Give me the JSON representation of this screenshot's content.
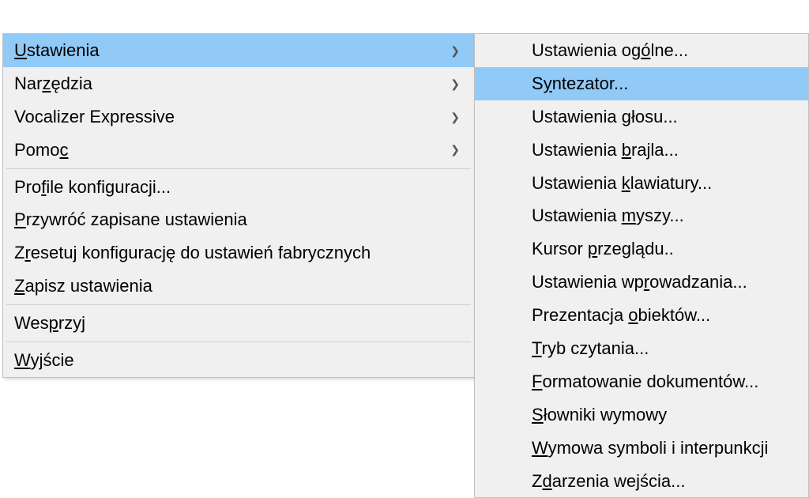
{
  "leftMenu": {
    "items": [
      {
        "label": "Ustawienia",
        "underlineIndex": 0,
        "hasArrow": true,
        "highlight": true
      },
      {
        "label": "Narzędzia",
        "underlineIndex": 3,
        "hasArrow": true,
        "highlight": false
      },
      {
        "label": "Vocalizer Expressive",
        "underlineIndex": -1,
        "hasArrow": true,
        "highlight": false
      },
      {
        "label": "Pomoc",
        "underlineIndex": 4,
        "hasArrow": true,
        "highlight": false
      }
    ],
    "items2": [
      {
        "label": "Profile konfiguracji...",
        "underlineIndex": 3,
        "hasArrow": false,
        "highlight": false
      },
      {
        "label": "Przywróć zapisane ustawienia",
        "underlineIndex": 0,
        "hasArrow": false,
        "highlight": false
      },
      {
        "label": "Zresetuj konfigurację do ustawień fabrycznych",
        "underlineIndex": 1,
        "hasArrow": false,
        "highlight": false
      },
      {
        "label": "Zapisz ustawienia",
        "underlineIndex": 0,
        "hasArrow": false,
        "highlight": false
      }
    ],
    "items3": [
      {
        "label": "Wesprzyj",
        "underlineIndex": 3,
        "hasArrow": false,
        "highlight": false
      }
    ],
    "items4": [
      {
        "label": "Wyjście",
        "underlineIndex": 0,
        "hasArrow": false,
        "highlight": false
      }
    ]
  },
  "rightMenu": {
    "items": [
      {
        "label": "Ustawienia ogólne...",
        "underlineIndex": 13,
        "highlight": false
      },
      {
        "label": "Syntezator...",
        "underlineIndex": 1,
        "highlight": true
      },
      {
        "label": "Ustawienia głosu...",
        "underlineIndex": 11,
        "highlight": false
      },
      {
        "label": "Ustawienia brajla...",
        "underlineIndex": 11,
        "highlight": false
      },
      {
        "label": "Ustawienia klawiatury...",
        "underlineIndex": 11,
        "highlight": false
      },
      {
        "label": "Ustawienia myszy...",
        "underlineIndex": 11,
        "highlight": false
      },
      {
        "label": "Kursor przeglądu..",
        "underlineIndex": 7,
        "highlight": false
      },
      {
        "label": "Ustawienia wprowadzania...",
        "underlineIndex": 13,
        "highlight": false
      },
      {
        "label": "Prezentacja obiektów...",
        "underlineIndex": 12,
        "highlight": false
      },
      {
        "label": "Tryb czytania...",
        "underlineIndex": 0,
        "highlight": false
      },
      {
        "label": "Formatowanie dokumentów...",
        "underlineIndex": 0,
        "highlight": false
      },
      {
        "label": "Słowniki wymowy",
        "underlineIndex": 0,
        "highlight": false
      },
      {
        "label": "Wymowa symboli i interpunkcji",
        "underlineIndex": 0,
        "highlight": false
      },
      {
        "label": "Zdarzenia wejścia...",
        "underlineIndex": 1,
        "highlight": false
      }
    ]
  }
}
